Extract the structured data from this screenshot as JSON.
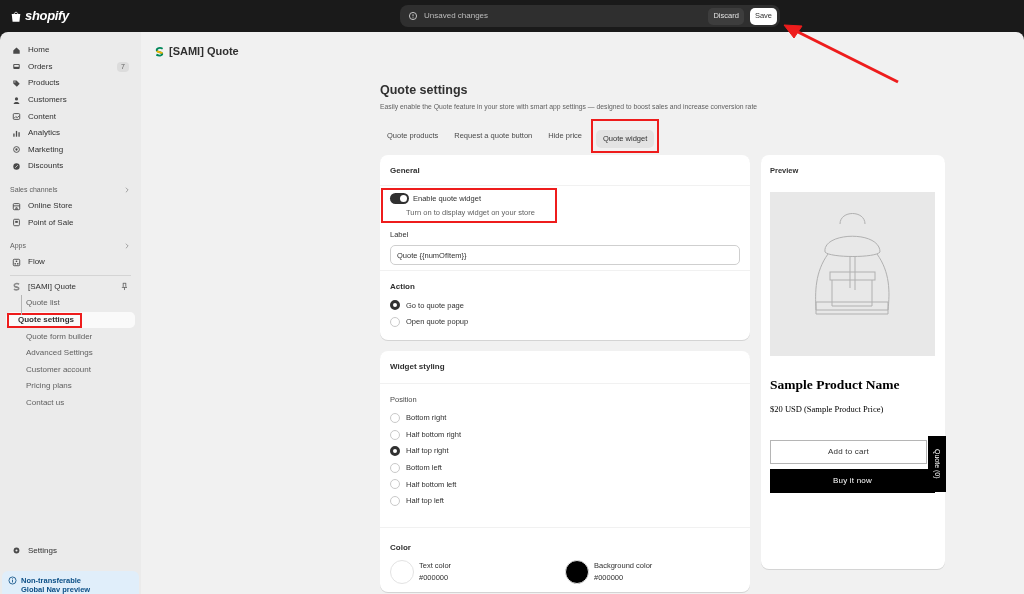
{
  "topbar": {
    "logo": "shopify",
    "save_bar": {
      "message": "Unsaved changes",
      "buttons": [
        {
          "label": "Discard",
          "kind": "secondary",
          "annotated": false
        },
        {
          "label": "Save",
          "kind": "primary",
          "annotated": true
        }
      ]
    }
  },
  "sidebar": {
    "items": [
      {
        "label": "Home"
      },
      {
        "label": "Orders",
        "badge": "7"
      },
      {
        "label": "Products"
      },
      {
        "label": "Customers"
      },
      {
        "label": "Content"
      },
      {
        "label": "Analytics"
      },
      {
        "label": "Marketing"
      },
      {
        "label": "Discounts"
      }
    ],
    "sections": [
      {
        "title": "Sales channels",
        "items": [
          {
            "label": "Online Store"
          },
          {
            "label": "Point of Sale"
          }
        ]
      },
      {
        "title": "Apps",
        "items": [
          {
            "label": "Flow"
          }
        ]
      }
    ],
    "app": {
      "label": "[SAMI] Quote",
      "children": [
        {
          "label": "Quote list",
          "selected": false,
          "highlighted": false
        },
        {
          "label": "Quote settings",
          "selected": true,
          "highlighted": true
        },
        {
          "label": "Quote form builder",
          "selected": false,
          "highlighted": false
        },
        {
          "label": "Advanced Settings",
          "selected": false,
          "highlighted": false
        },
        {
          "label": "Customer account",
          "selected": false,
          "highlighted": false
        },
        {
          "label": "Pricing plans",
          "selected": false,
          "highlighted": false
        },
        {
          "label": "Contact us",
          "selected": false,
          "highlighted": false
        }
      ]
    },
    "settings": "Settings",
    "banner": [
      "Non-transferable",
      "Global Nav preview"
    ]
  },
  "page": {
    "app_title": "[SAMI] Quote",
    "heading": "Quote settings",
    "description": "Easily enable the Quote feature in your store with smart app settings — designed to boost sales and increase conversion rate",
    "tabs": [
      {
        "label": "Quote products",
        "selected": false,
        "highlighted": false
      },
      {
        "label": "Request a quote button",
        "selected": false,
        "highlighted": false
      },
      {
        "label": "Hide price",
        "selected": false,
        "highlighted": false
      },
      {
        "label": "Quote widget",
        "selected": true,
        "highlighted": true
      }
    ],
    "general": {
      "title": "General",
      "toggle": {
        "label": "Enable quote widget",
        "hint": "Turn on to display widget on your store",
        "on": true,
        "highlighted": true
      },
      "field": {
        "label": "Label",
        "value": "Quote {{numOfItem}}"
      },
      "action": {
        "title": "Action",
        "options": [
          {
            "label": "Go to quote page",
            "selected": true
          },
          {
            "label": "Open quote popup",
            "selected": false
          }
        ]
      }
    },
    "styling": {
      "title": "Widget styling",
      "position": {
        "title": "Position",
        "options": [
          {
            "label": "Bottom right",
            "selected": false
          },
          {
            "label": "Half bottom right",
            "selected": false
          },
          {
            "label": "Half top right",
            "selected": true
          },
          {
            "label": "Bottom left",
            "selected": false
          },
          {
            "label": "Half bottom left",
            "selected": false
          },
          {
            "label": "Half top left",
            "selected": false
          }
        ]
      },
      "color": {
        "title": "Color",
        "swatches": [
          {
            "label": "Text color",
            "value": "#000000",
            "color": "#ffffff"
          },
          {
            "label": "Background color",
            "value": "#000000",
            "color": "#000000"
          }
        ]
      }
    },
    "preview": {
      "title": "Preview",
      "product_name": "Sample Product Name",
      "price": "$20 USD (Sample Product Price)",
      "buttons": [
        {
          "label": "Add to cart",
          "kind": "outline"
        },
        {
          "label": "Buy it now",
          "kind": "solid"
        }
      ],
      "widget_label": "Quote (0)"
    }
  }
}
